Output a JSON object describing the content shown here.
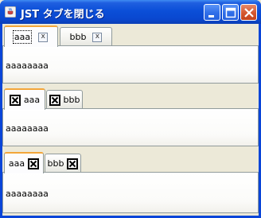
{
  "window": {
    "title": "JST タブを閉じる",
    "controls": {
      "minimize": "minimize",
      "maximize": "maximize",
      "close": "close"
    }
  },
  "tabbed_panes": [
    {
      "style": "small-close-button-right",
      "tabs": [
        {
          "label": "aaa",
          "selected": true,
          "close_glyph": "x"
        },
        {
          "label": "bbb",
          "selected": false,
          "close_glyph": "x"
        }
      ],
      "content": "aaaaaaaa"
    },
    {
      "style": "close-button-left",
      "tabs": [
        {
          "label": "aaa",
          "selected": true
        },
        {
          "label": "bbb",
          "selected": false
        }
      ],
      "content": "aaaaaaaa"
    },
    {
      "style": "close-button-right",
      "tabs": [
        {
          "label": "aaa",
          "selected": true
        },
        {
          "label": "bbb",
          "selected": false
        }
      ],
      "content": "aaaaaaaa"
    }
  ],
  "colors": {
    "titlebar": "#0b4fd8",
    "selected_tab_highlight": "#f3a63a",
    "background": "#ece9d8",
    "panel_border": "#919b9c"
  }
}
